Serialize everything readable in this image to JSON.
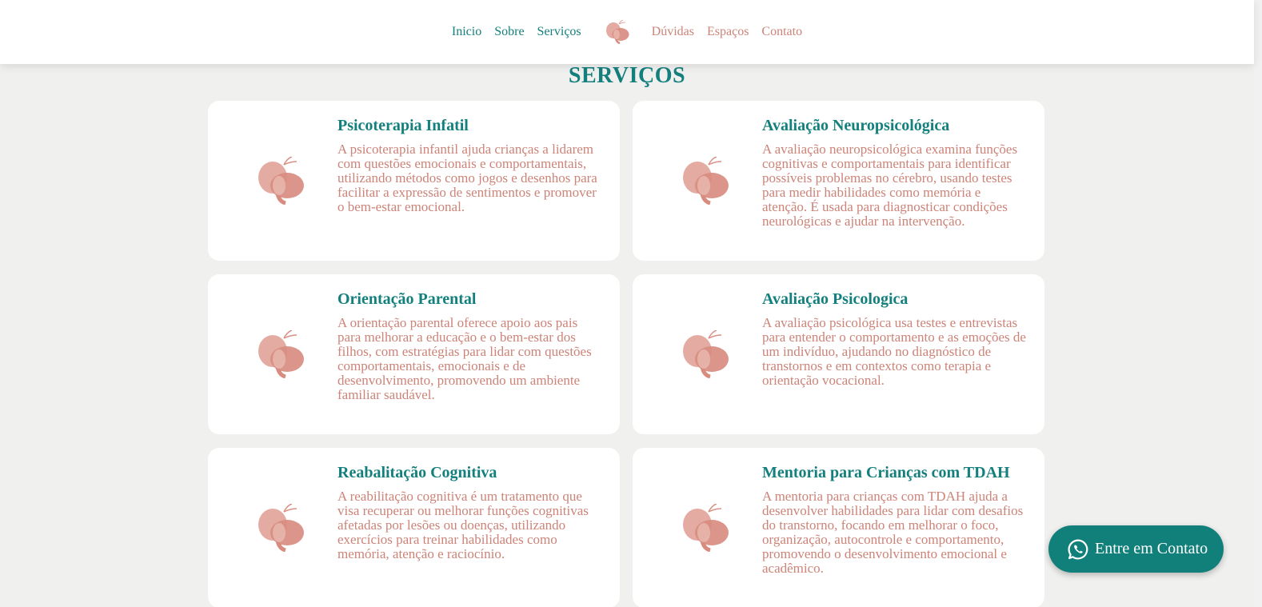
{
  "nav": {
    "left_links": [
      "Inicio",
      "Sobre",
      "Serviços"
    ],
    "right_links": [
      "Dúvidas",
      "Espaços",
      "Contato"
    ],
    "logo_icon": "butterfly-icon"
  },
  "section": {
    "title": "SERVIÇOS"
  },
  "services": [
    {
      "title": "Psicoterapia Infatil",
      "description": "A psicoterapia infantil ajuda crianças a lidarem com questões emocionais e comportamentais, utilizando métodos como jogos e desenhos para facilitar a expressão de sentimentos e promover o bem-estar emocional.",
      "icon": "butterfly-icon"
    },
    {
      "title": "Avaliação Neuropsicológica",
      "description": "A avaliação neuropsicológica examina funções cognitivas e comportamentais para identificar possíveis problemas no cérebro, usando testes para medir habilidades como memória e atenção. É usada para diagnosticar condições neurológicas e ajudar na intervenção.",
      "icon": "butterfly-icon"
    },
    {
      "title": "Orientação Parental",
      "description": "A orientação parental oferece apoio aos pais para melhorar a educação e o bem-estar dos filhos, com estratégias para lidar com questões comportamentais, emocionais e de desenvolvimento, promovendo um ambiente familiar saudável.",
      "icon": "butterfly-icon"
    },
    {
      "title": "Avaliação Psicologica",
      "description": "A avaliação psicológica usa testes e entrevistas para entender o comportamento e as emoções de um indivíduo, ajudando no diagnóstico de transtornos e em contextos como terapia e orientação vocacional.",
      "icon": "butterfly-icon"
    },
    {
      "title": "Reabalitação Cognitiva",
      "description": "A reabilitação cognitiva é um tratamento que visa recuperar ou melhorar funções cognitivas afetadas por lesões ou doenças, utilizando exercícios para treinar habilidades como memória, atenção e raciocínio.",
      "icon": "butterfly-icon"
    },
    {
      "title": "Mentoria para Crianças com TDAH",
      "description": "A mentoria para crianças com TDAH ajuda a desenvolver habilidades para lidar com desafios do transtorno, focando em melhorar o foco, organização, autocontrole e comportamento, promovendo o desenvolvimento emocional e acadêmico.",
      "icon": "butterfly-icon"
    }
  ],
  "contact_button": {
    "label": "Entre em Contato",
    "icon": "whatsapp-icon"
  },
  "colors": {
    "teal": "#14807d",
    "salmon": "#cc8378",
    "background": "#f0f0ef"
  }
}
